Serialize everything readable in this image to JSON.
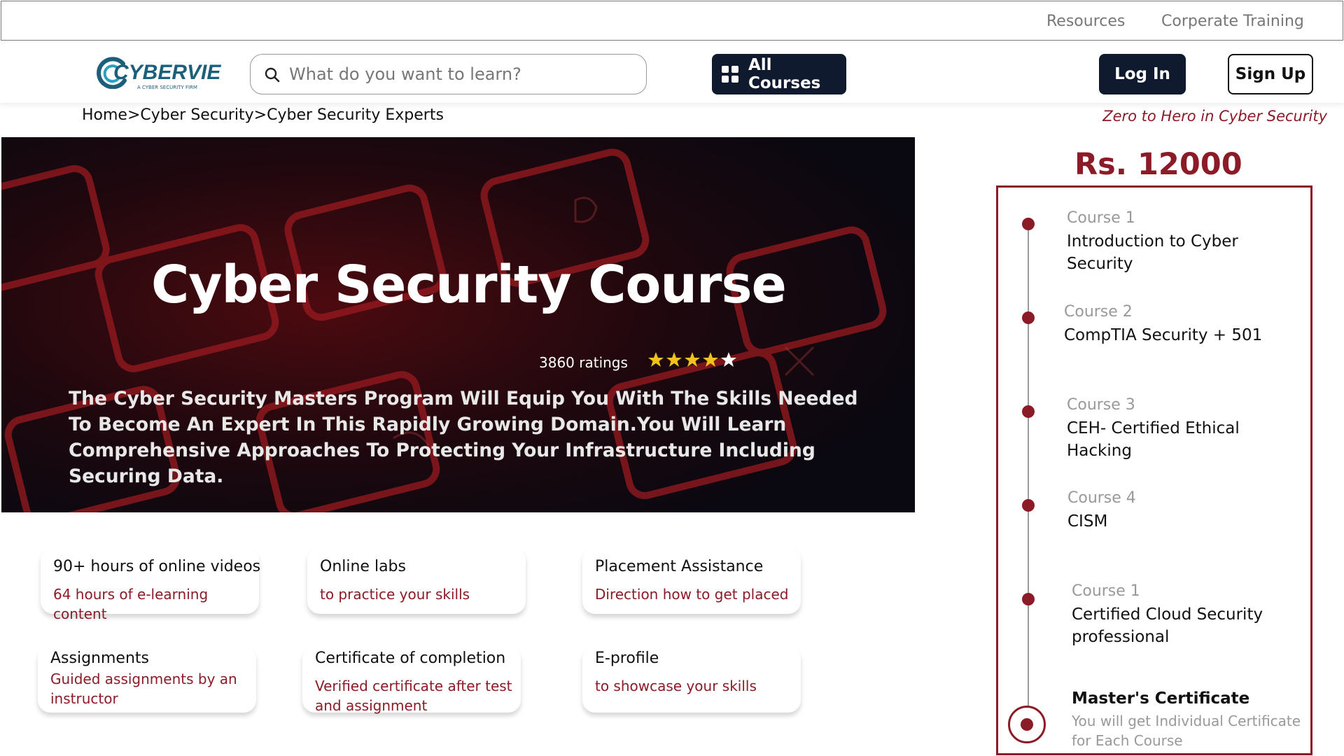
{
  "topbar": {
    "resources": "Resources",
    "corporate_training": "Corperate Training"
  },
  "header": {
    "logo_text": "CYBERVIE",
    "logo_tagline": "A CYBER SECURITY FIRM",
    "search_placeholder": "What do you want to learn?",
    "all_courses": "All Courses",
    "login": "Log In",
    "signup": "Sign Up"
  },
  "breadcrumb": {
    "home": "Home",
    "sep": ">",
    "section": "Cyber Security",
    "page": "Cyber Security Experts"
  },
  "tagline": "Zero to Hero in Cyber Security",
  "hero": {
    "title": "Cyber Security Course",
    "ratings": "3860 ratings",
    "stars": 4,
    "stars_max": 5,
    "description": "The Cyber Security Masters Program Will Equip You With The Skills Needed To Become An Expert In This Rapidly Growing Domain.You Will Learn Comprehensive Approaches To Protecting Your Infrastructure Including Securing Data."
  },
  "features": [
    {
      "title": "90+ hours of online videos",
      "desc": "64 hours of e-learning content"
    },
    {
      "title": "Online labs",
      "desc": "to practice your skills"
    },
    {
      "title": "Placement Assistance",
      "desc": "Direction how to get placed"
    },
    {
      "title": "Assignments",
      "desc": "Guided assignments by an instructor"
    },
    {
      "title": "Certificate of completion",
      "desc": "Verified certificate after test and assignment"
    },
    {
      "title": "E-profile",
      "desc": "to showcase your skills"
    }
  ],
  "price": "Rs. 12000",
  "curriculum": [
    {
      "num": "Course 1",
      "name": "Introduction to Cyber Security"
    },
    {
      "num": "Course 2",
      "name": "CompTIA Security + 501"
    },
    {
      "num": "Course 3",
      "name": "CEH- Certified Ethical Hacking"
    },
    {
      "num": "Course 4",
      "name": "CISM"
    },
    {
      "num": "Course 1",
      "name": "Certified Cloud Security professional"
    }
  ],
  "final": {
    "name": "Master's Certificate",
    "desc": "You will get Individual Certificate for Each Course"
  },
  "colors": {
    "accent": "#8b1c27",
    "dark": "#0f1a2e",
    "star": "#f2c21a"
  }
}
